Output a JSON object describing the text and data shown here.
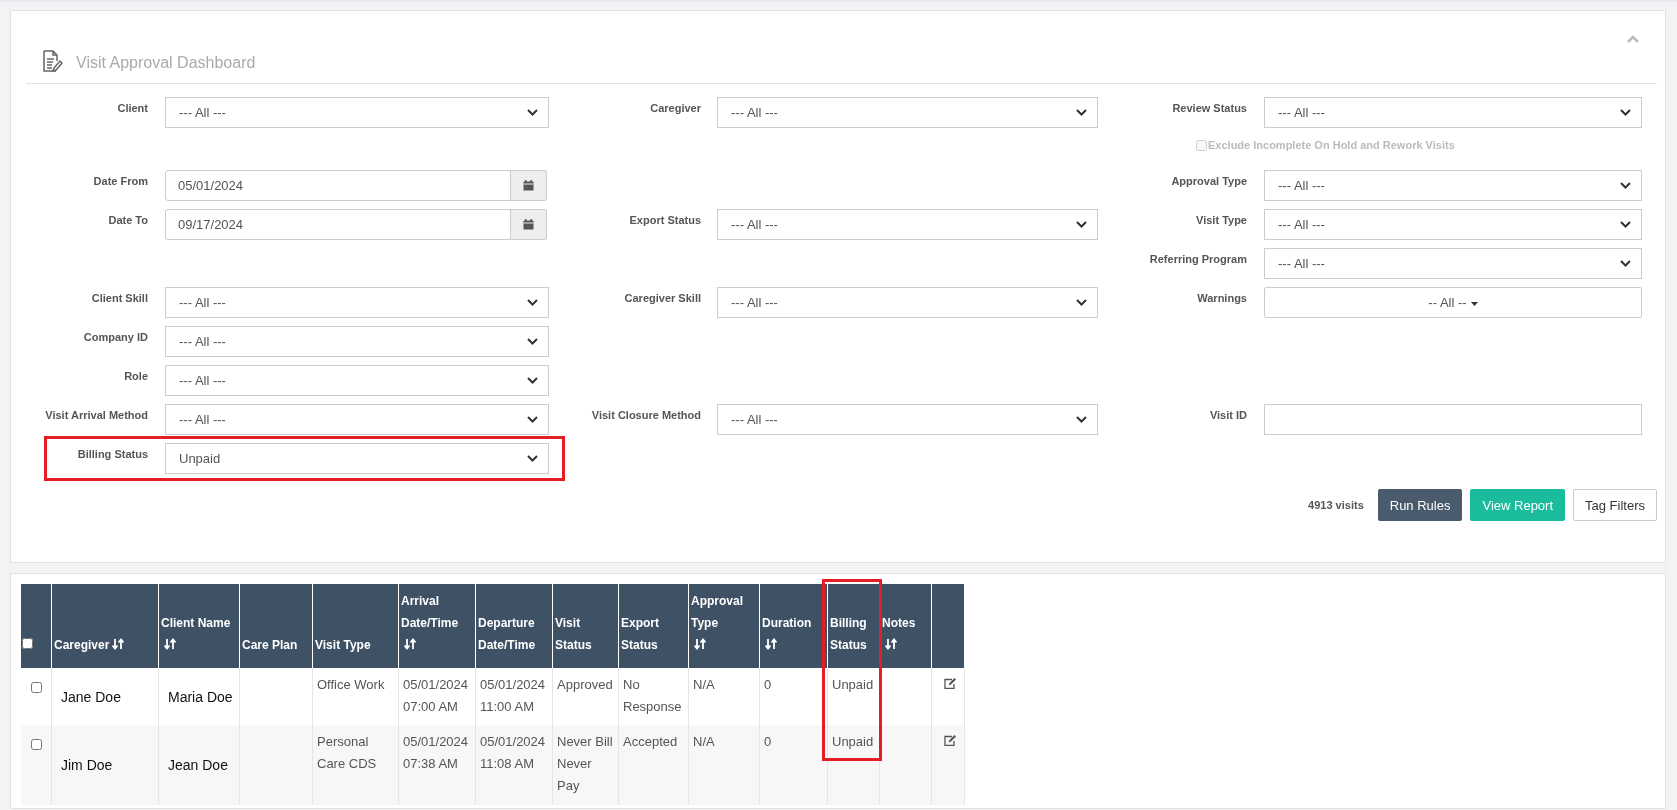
{
  "dashboard": {
    "title": "Visit Approval Dashboard"
  },
  "filters": [
    {
      "left": {
        "label": "Client",
        "kind": "select",
        "value": "--- All ---",
        "highlighted": false
      },
      "middle": {
        "label": "Caregiver",
        "kind": "select",
        "value": "--- All ---",
        "highlighted": false
      },
      "right": {
        "label": "Review Status",
        "kind": "select",
        "value": "--- All ---",
        "highlighted": false
      }
    },
    {
      "right": {
        "label": "Exclude Incomplete On Hold and Rework Visits",
        "kind": "checkbox",
        "checked": false,
        "disabled": true,
        "highlighted": false
      }
    },
    {
      "left": {
        "label": "Date From",
        "kind": "date",
        "value": "05/01/2024",
        "highlighted": false
      },
      "right": {
        "label": "Approval Type",
        "kind": "select",
        "value": "--- All ---",
        "highlighted": false
      }
    },
    {
      "left": {
        "label": "Date To",
        "kind": "date",
        "value": "09/17/2024",
        "highlighted": false
      },
      "middle": {
        "label": "Export Status",
        "kind": "select",
        "value": "--- All ---",
        "highlighted": false
      },
      "right": {
        "label": "Visit Type",
        "kind": "select",
        "value": "--- All ---",
        "highlighted": false
      }
    },
    {
      "right": {
        "label": "Referring Program",
        "kind": "select",
        "value": "--- All ---",
        "highlighted": false
      }
    },
    {
      "left": {
        "label": "Client Skill",
        "kind": "select",
        "value": "--- All ---",
        "highlighted": false
      },
      "middle": {
        "label": "Caregiver Skill",
        "kind": "select",
        "value": "--- All ---",
        "highlighted": false
      },
      "right": {
        "label": "Warnings",
        "kind": "menu",
        "value": "-- All --",
        "highlighted": false
      }
    },
    {
      "left": {
        "label": "Company ID",
        "kind": "select",
        "value": "--- All ---",
        "highlighted": false
      }
    },
    {
      "left": {
        "label": "Role",
        "kind": "select",
        "value": "--- All ---",
        "highlighted": false
      }
    },
    {
      "left": {
        "label": "Visit Arrival Method",
        "kind": "select",
        "value": "--- All ---",
        "highlighted": false
      },
      "middle": {
        "label": "Visit Closure Method",
        "kind": "select",
        "value": "--- All ---",
        "highlighted": false
      },
      "right": {
        "label": "Visit ID",
        "kind": "text",
        "highlighted": false
      }
    },
    {
      "left": {
        "label": "Billing Status",
        "kind": "select",
        "value": "Unpaid",
        "highlighted": true
      }
    }
  ],
  "summary": {
    "count": "4913 visits",
    "buttons": [
      {
        "label": "Run Rules",
        "kind": "dark"
      },
      {
        "label": "View Report",
        "kind": "green"
      },
      {
        "label": "Tag Filters",
        "kind": "plain"
      }
    ]
  },
  "table": {
    "select_all": {
      "checked": false
    },
    "columns": [
      {
        "label": "Caregiver",
        "sortable": true,
        "highlighted": false
      },
      {
        "label": "Client Name",
        "sortable": true,
        "highlighted": false
      },
      {
        "label": "Care Plan",
        "sortable": false,
        "highlighted": false
      },
      {
        "label": "Visit Type",
        "sortable": false,
        "highlighted": false
      },
      {
        "label": "Arrival Date/Time",
        "sortable": true,
        "highlighted": false
      },
      {
        "label": "Departure Date/Time",
        "sortable": false,
        "highlighted": false
      },
      {
        "label": "Visit Status",
        "sortable": false,
        "highlighted": false
      },
      {
        "label": "Export Status",
        "sortable": false,
        "highlighted": false
      },
      {
        "label": "Approval Type",
        "sortable": true,
        "highlighted": false
      },
      {
        "label": "Duration",
        "sortable": true,
        "highlighted": false
      },
      {
        "label": "Billing Status",
        "sortable": false,
        "highlighted": true
      },
      {
        "label": "Notes",
        "sortable": true,
        "highlighted": false
      }
    ],
    "rows": [
      {
        "checked": false,
        "cells": [
          "Jane Doe",
          "Maria Doe",
          "",
          "Office Work",
          "05/01/2024 07:00 AM",
          "05/01/2024 11:00 AM",
          "Approved",
          "No Response",
          "N/A",
          "0",
          "Unpaid",
          ""
        ]
      },
      {
        "checked": false,
        "cells": [
          "Jim Doe",
          "Jean Doe",
          "",
          "Personal Care CDS",
          "05/01/2024 07:38 AM",
          "05/01/2024 11:08 AM",
          "Never Bill Never Pay",
          "Accepted",
          "N/A",
          "0",
          "Unpaid",
          ""
        ]
      }
    ]
  }
}
